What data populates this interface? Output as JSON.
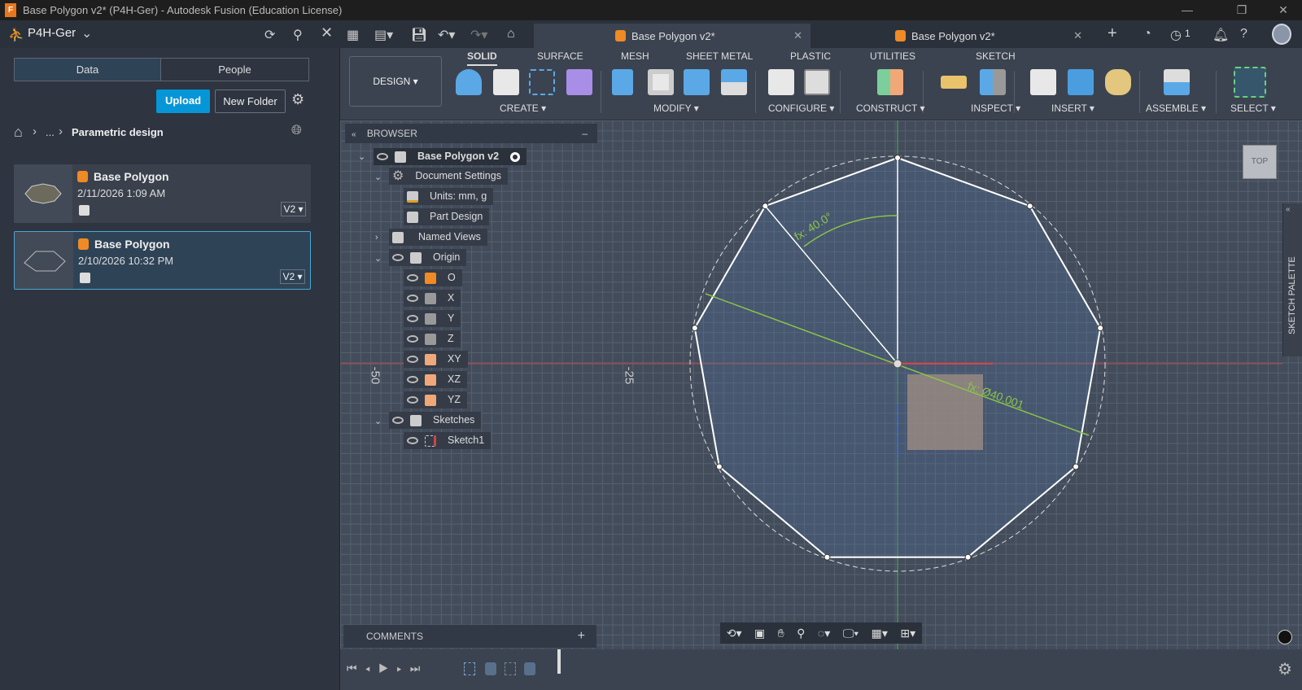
{
  "title_bar": {
    "title": "Base Polygon v2* (P4H-Ger) - Autodesk Fusion (Education License)",
    "app_logo": "F",
    "minimize": "—",
    "restore": "❐",
    "close": "✕"
  },
  "header": {
    "team": "P4H-Ger",
    "tabs": [
      {
        "label": "Base Polygon v2*",
        "active": true
      },
      {
        "label": "Base Polygon v2*",
        "active": false
      }
    ],
    "jobs_count": "1"
  },
  "left_panel": {
    "tabs": [
      "Data",
      "People"
    ],
    "upload": "Upload",
    "new_folder": "New Folder",
    "breadcrumb": {
      "ellipsis": "...",
      "current": "Parametric design"
    },
    "files": [
      {
        "name": "Base Polygon",
        "date": "2/11/2026 1:09 AM",
        "version": "V2"
      },
      {
        "name": "Base Polygon",
        "date": "2/10/2026 10:32 PM",
        "version": "V2",
        "selected": true
      }
    ]
  },
  "ribbon": {
    "workspace": "DESIGN",
    "tabs": [
      "SOLID",
      "SURFACE",
      "MESH",
      "SHEET METAL",
      "PLASTIC",
      "UTILITIES",
      "SKETCH"
    ],
    "active_tab": "SOLID",
    "groups": [
      "CREATE",
      "MODIFY",
      "CONFIGURE",
      "CONSTRUCT",
      "INSPECT",
      "INSERT",
      "ASSEMBLE",
      "SELECT"
    ]
  },
  "browser": {
    "title": "BROWSER",
    "items": [
      "Base Polygon v2",
      "Document Settings",
      "Units: mm, g",
      "Part Design",
      "Named Views",
      "Origin",
      "O",
      "X",
      "Y",
      "Z",
      "XY",
      "XZ",
      "YZ",
      "Sketches",
      "Sketch1"
    ]
  },
  "viewport": {
    "ruler": [
      "-50",
      "-25"
    ],
    "angle_dim": "fx: 40.0°",
    "diameter_dim": "fx: Ø40.001",
    "viewcube": "TOP",
    "sketch_palette": "SKETCH PALETTE",
    "polygon_sides": 9
  },
  "comments": {
    "label": "COMMENTS",
    "add": "+"
  },
  "colors": {
    "accent": "#0696d7",
    "x_axis": "#d23b3b",
    "y_axis": "#4caf50",
    "dimension": "#8bc34a"
  }
}
